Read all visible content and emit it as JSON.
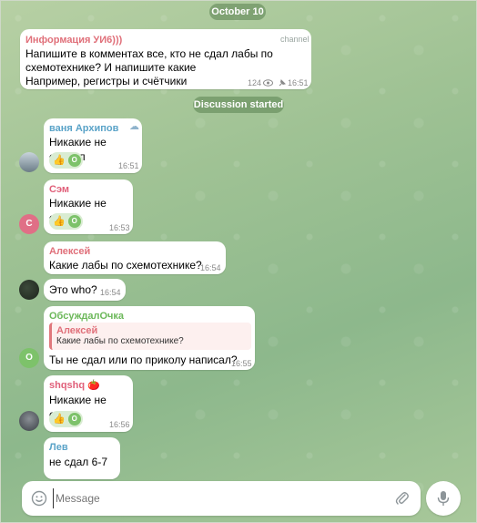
{
  "date_separator": "October 10",
  "service_message": "Discussion started",
  "channel_post": {
    "author": "Информация УИ6)))",
    "tag": "channel",
    "lines": [
      "Напишите в комментах все, кто не сдал лабы по",
      "схемотехнике? И напишите какие",
      "Например, регистры и счётчики"
    ],
    "views": "124",
    "time": "16:51"
  },
  "messages": [
    {
      "author": "ваня Архипов",
      "author_color": "#5aa3c8",
      "text": "Никакие не сдавал",
      "time": "16:51",
      "reaction": "👍"
    },
    {
      "author": "Сэм",
      "author_color": "#e0607a",
      "avatar_letter": "С",
      "text": "Никакие не сдал",
      "time": "16:53",
      "reaction": "👍"
    },
    {
      "author": "Алексей",
      "author_color": "#e0707a",
      "text": "Какие лабы по схемотехнике?",
      "time": "16:54"
    },
    {
      "text": "Это who?",
      "time": "16:54"
    },
    {
      "author": "ОбсуждалОчка",
      "author_color": "#6cb85a",
      "avatar_letter": "О",
      "reply_author": "Алексей",
      "reply_text": "Какие лабы по схемотехнике?",
      "text": "Ты не сдал или по приколу написал?",
      "time": "16:55"
    },
    {
      "author": "shqshq 🍅",
      "author_color": "#e0607a",
      "text": "Никакие не сдал",
      "time": "16:56",
      "reaction": "👍"
    },
    {
      "author": "Лев",
      "author_color": "#5aa3c8",
      "text": "не сдал 6-7"
    }
  ],
  "reaction_avatar_letter": "О",
  "composer": {
    "placeholder": "Message"
  },
  "colors": {
    "accent": "#5aa3c8",
    "bubble": "#ffffff",
    "reaction_bg": "#d9ecd2"
  }
}
